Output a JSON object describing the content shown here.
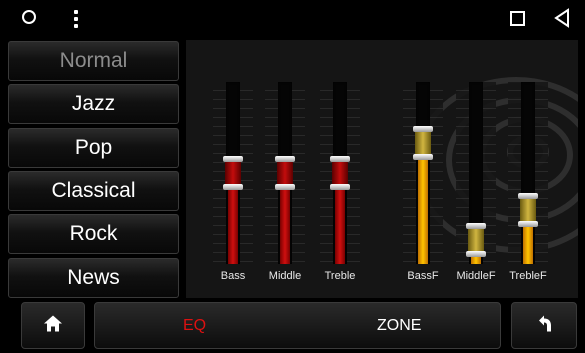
{
  "statusbar": {
    "icons": [
      "circle-icon",
      "more-vertical-icon",
      "square-icon",
      "back-triangle-icon"
    ]
  },
  "presets": [
    {
      "label": "Normal",
      "active": true
    },
    {
      "label": "Jazz",
      "active": false
    },
    {
      "label": "Pop",
      "active": false
    },
    {
      "label": "Classical",
      "active": false
    },
    {
      "label": "Rock",
      "active": false
    },
    {
      "label": "News",
      "active": false
    }
  ],
  "eq": {
    "sliders": [
      {
        "label": "Bass",
        "level": 0.5,
        "color": "#d01010"
      },
      {
        "label": "Middle",
        "level": 0.5,
        "color": "#d01010"
      },
      {
        "label": "Treble",
        "level": 0.5,
        "color": "#d01010"
      },
      {
        "label": "BassF",
        "level": 0.7,
        "color": "#ffc400"
      },
      {
        "label": "MiddleF",
        "level": 0.05,
        "color": "#ffc400"
      },
      {
        "label": "TrebleF",
        "level": 0.25,
        "color": "#ffc400"
      }
    ]
  },
  "bottom": {
    "home_icon": "home-icon",
    "eq_label": "EQ",
    "zone_label": "ZONE",
    "back_icon": "return-arrow-icon",
    "active_color": "#dd1111"
  }
}
